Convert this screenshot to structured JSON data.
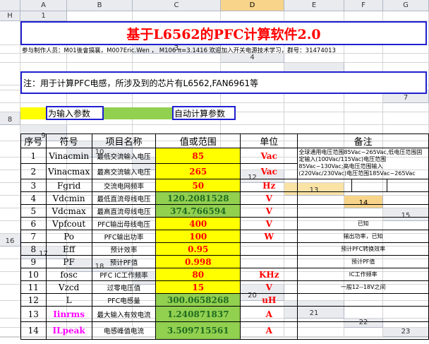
{
  "columns": [
    "A",
    "B",
    "C",
    "D",
    "E",
    "F",
    "G",
    "H"
  ],
  "rows": [
    "1",
    "2",
    "3",
    "4",
    "5",
    "6",
    "7",
    "8",
    "9",
    "10",
    "11",
    "12",
    "13",
    "14",
    "15",
    "16",
    "17",
    "18",
    "19",
    "20",
    "21",
    "22",
    "23"
  ],
  "title": "基于L6562的PFC计算软件2.0",
  "credits": "参与制作人员：M01後會搞襄，M007Eric.Wen ， M106 π=3.1416 欢迎加入开关电源技术学习，群号：31474013",
  "note": "注：用于计算PFC电感，所涉及到的芯片有L6562,FAN6961等",
  "legend": {
    "input_label": "为输入参数",
    "calc_label": "自动计算参数"
  },
  "table": {
    "headers": [
      "序号",
      "符号",
      "项目名称",
      "值或范围",
      "单位",
      "备注"
    ],
    "rows": [
      {
        "idx": "1",
        "sym": "Vinacmin",
        "name": "最低交流输入电压",
        "value": "85",
        "kind": "in",
        "unit": "Vac",
        "remark": "全球通用电压范围85Vac~265Vac,低电压范围固定输入(100Vac/115Vac)电压范围85Vac~130Vac;高电压范围输入(220Vac/230Vac)电压范围185Vac~265Vac"
      },
      {
        "idx": "2",
        "sym": "Vinacmax",
        "name": "最高交流输入电压",
        "value": "265",
        "kind": "in",
        "unit": "Vac",
        "remark": ""
      },
      {
        "idx": "3",
        "sym": "Fgrid",
        "name": "交流电网频率",
        "value": "50",
        "kind": "in",
        "unit": "Hz",
        "remark": ""
      },
      {
        "idx": "4",
        "sym": "Vdcmin",
        "name": "最低直流母线电压",
        "value": "120.2081528",
        "kind": "calc",
        "unit": "V",
        "remark": ""
      },
      {
        "idx": "5",
        "sym": "Vdcmax",
        "name": "最高直流母线电压",
        "value": "374.766594",
        "kind": "calc",
        "unit": "V",
        "remark": ""
      },
      {
        "idx": "6",
        "sym": "Vpfcout",
        "name": "PFC输出母线电压",
        "value": "400",
        "kind": "in",
        "unit": "V",
        "remark": "已知"
      },
      {
        "idx": "7",
        "sym": "Po",
        "name": "PFC输出功率",
        "value": "100",
        "kind": "in",
        "unit": "W",
        "remark": "输出功率，已知"
      },
      {
        "idx": "8",
        "sym": "Eff",
        "name": "预计效率",
        "value": "0.95",
        "kind": "in",
        "unit": "",
        "remark": "预计PFC转换效率"
      },
      {
        "idx": "9",
        "sym": "PF",
        "name": "预计PF值",
        "value": "0.998",
        "kind": "in",
        "unit": "",
        "remark": "预计PF值"
      },
      {
        "idx": "10",
        "sym": "fosc",
        "name": "PFC IC工作频率",
        "value": "80",
        "kind": "in",
        "unit": "KHz",
        "remark": "IC工作频率"
      },
      {
        "idx": "11",
        "sym": "Vzcd",
        "name": "过零电压值",
        "value": "15",
        "kind": "in",
        "unit": "V",
        "remark": "一般12--18V之间"
      },
      {
        "idx": "12",
        "sym": "L",
        "name": "PFC电感量",
        "value": "300.0658268",
        "kind": "calc",
        "unit": "uH",
        "remark": ""
      },
      {
        "idx": "13",
        "sym": "Iinrms",
        "name": "最大输入有效电流",
        "value": "1.240871837",
        "kind": "calc",
        "unit": "A",
        "remark": "",
        "mag": true
      },
      {
        "idx": "14",
        "sym": "ILpeak",
        "name": "电感峰值电流",
        "value": "3.509715561",
        "kind": "calc",
        "unit": "A",
        "remark": "",
        "mag": true
      }
    ]
  }
}
